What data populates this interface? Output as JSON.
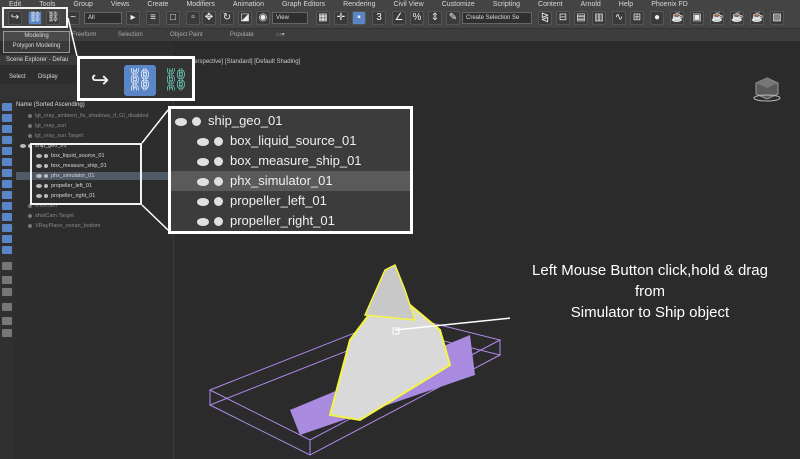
{
  "menu": [
    "Edit",
    "Tools",
    "Group",
    "Views",
    "Create",
    "Modifiers",
    "Animation",
    "Graph Editors",
    "Rendering",
    "Civil View",
    "Customize",
    "Scripting",
    "Content",
    "Arnold",
    "Help",
    "Phoenix FD"
  ],
  "toolbar": {
    "filter_value": "All",
    "view_value": "View",
    "selection_set_placeholder": "Create Selection Se"
  },
  "ribbon": {
    "tabs": [
      "Modeling",
      "Freeform",
      "Selection",
      "Object Paint",
      "Populate"
    ],
    "sub_label": "Polygon Modeling"
  },
  "scene_explorer": {
    "title": "Scene Explorer - Defau",
    "tabs": [
      "Select",
      "Display"
    ],
    "list_header": "Name (Sorted Ascending)",
    "rows": [
      {
        "label": "lgt_vray_ambient_fix_shadows_if_GI_disabled",
        "dim": true
      },
      {
        "label": "lgt_vray_sun",
        "dim": true
      },
      {
        "label": "lgt_vray_sun.Target",
        "dim": true
      },
      {
        "label": "ship_geo_01",
        "dim": false
      },
      {
        "label": "box_liquid_source_01",
        "dim": false
      },
      {
        "label": "box_measure_ship_01",
        "dim": false
      },
      {
        "label": "phx_simulator_01",
        "dim": false
      },
      {
        "label": "propeller_left_01",
        "dim": false
      },
      {
        "label": "propeller_right_01",
        "dim": false
      },
      {
        "label": "shotCam",
        "dim": true
      },
      {
        "label": "shotCam.Target",
        "dim": true
      },
      {
        "label": "VRayPlane_ocean_bottom",
        "dim": true
      }
    ]
  },
  "viewport": {
    "label": "[+] [Perspective] [Standard] [Default Shading]"
  },
  "zoom_tree": {
    "parent": "ship_geo_01",
    "children": [
      "box_liquid_source_01",
      "box_measure_ship_01",
      "phx_simulator_01",
      "propeller_left_01",
      "propeller_right_01"
    ]
  },
  "annotation": {
    "line1": "Left Mouse Button click,hold & drag",
    "line2": "from",
    "line3": "Simulator to Ship object"
  },
  "colors": {
    "link_active": "#5a86c8",
    "highlight": "#f2f2f2",
    "simulator_box": "#b28af0",
    "ship_outline": "#f5f542",
    "liquid_source": "#a98be0"
  },
  "icons": {
    "undo": "redo-arrow-icon",
    "link": "link-icon",
    "unlink": "unlink-icon"
  }
}
